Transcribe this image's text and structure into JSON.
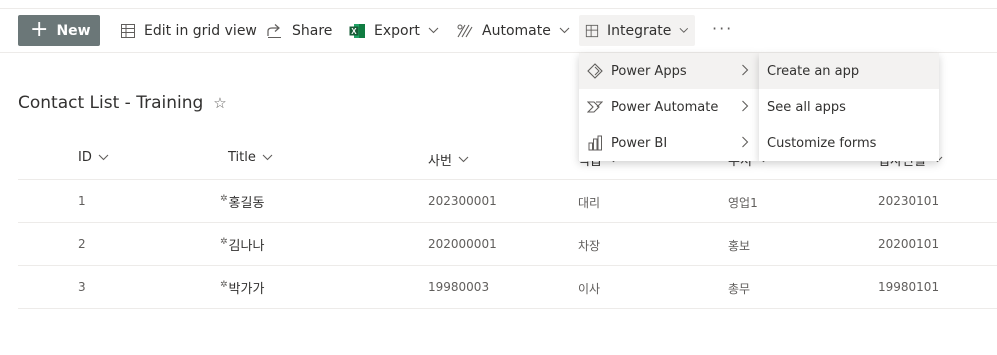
{
  "commandbar": {
    "new_label": "New",
    "edit_grid_label": "Edit in grid view",
    "share_label": "Share",
    "export_label": "Export",
    "automate_label": "Automate",
    "integrate_label": "Integrate",
    "more_label": "···"
  },
  "list": {
    "title": "Contact List - Training",
    "star": "☆"
  },
  "columns": [
    {
      "label": "ID"
    },
    {
      "label": "Title"
    },
    {
      "label": "사번"
    },
    {
      "label": "직급"
    },
    {
      "label": "부서"
    },
    {
      "label": "입사년월"
    }
  ],
  "rows": [
    {
      "id": "1",
      "title": "홍길동",
      "emp_no": "202300001",
      "rank": "대리",
      "dept": "영업1",
      "hire": "20230101"
    },
    {
      "id": "2",
      "title": "김나나",
      "emp_no": "202000001",
      "rank": "차장",
      "dept": "홍보",
      "hire": "20200101"
    },
    {
      "id": "3",
      "title": "박가가",
      "emp_no": "19980003",
      "rank": "이사",
      "dept": "총무",
      "hire": "19980101"
    }
  ],
  "integrate_menu": {
    "items": [
      {
        "label": "Power Apps",
        "icon": "power-apps-icon"
      },
      {
        "label": "Power Automate",
        "icon": "power-automate-icon"
      },
      {
        "label": "Power BI",
        "icon": "power-bi-icon"
      }
    ],
    "submenu": [
      {
        "label": "Create an app"
      },
      {
        "label": "See all apps"
      },
      {
        "label": "Customize forms"
      }
    ]
  },
  "colors": {
    "new_button_bg": "#6b7778",
    "excel_green": "#1d6f42",
    "border": "#edebe9",
    "hover_bg": "#f3f2f1"
  }
}
